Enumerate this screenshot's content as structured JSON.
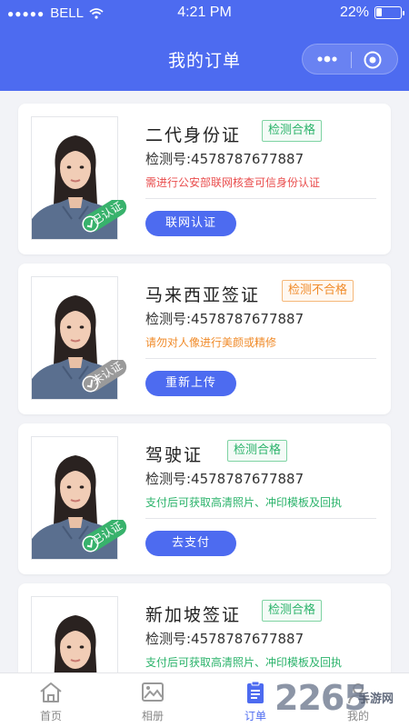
{
  "status_bar": {
    "carrier": "BELL",
    "time": "4:21 PM",
    "battery": "22%",
    "battery_level": 0.22
  },
  "header": {
    "title": "我的订单"
  },
  "orders": [
    {
      "title": "二代身份证",
      "status": "检测合格",
      "status_type": "ok",
      "detect_no": "检测号:4578787677887",
      "note": "需进行公安部联网核查可信身份认证",
      "note_color": "red",
      "badge": "已认证",
      "badge_type": "verified",
      "action": "联网认证"
    },
    {
      "title": "马来西亚签证",
      "status": "检测不合格",
      "status_type": "bad",
      "detect_no": "检测号:4578787677887",
      "note": "请勿对人像进行美颜或精修",
      "note_color": "orange",
      "badge": "未认证",
      "badge_type": "unverified",
      "action": "重新上传"
    },
    {
      "title": "驾驶证",
      "status": "检测合格",
      "status_type": "ok",
      "detect_no": "检测号:4578787677887",
      "note": "支付后可获取高清照片、冲印模板及回执",
      "note_color": "green",
      "badge": "已认证",
      "badge_type": "verified",
      "action": "去支付"
    },
    {
      "title": "新加坡签证",
      "status": "检测合格",
      "status_type": "ok",
      "detect_no": "检测号:4578787677887",
      "note": "支付后可获取高清照片、冲印模板及回执",
      "note_color": "green",
      "badge": "",
      "badge_type": "none",
      "action": ""
    }
  ],
  "tabbar": [
    {
      "label": "首页",
      "icon": "home-icon",
      "active": false
    },
    {
      "label": "相册",
      "icon": "album-icon",
      "active": false
    },
    {
      "label": "订单",
      "icon": "orders-icon",
      "active": true
    },
    {
      "label": "我的",
      "icon": "profile-icon",
      "active": false
    }
  ],
  "watermark": {
    "number": "2265",
    "text": "手游网"
  },
  "colors": {
    "primary": "#4d6bf0",
    "ok": "#2bb36b",
    "bad": "#f08b2a",
    "error": "#e94c4c"
  }
}
